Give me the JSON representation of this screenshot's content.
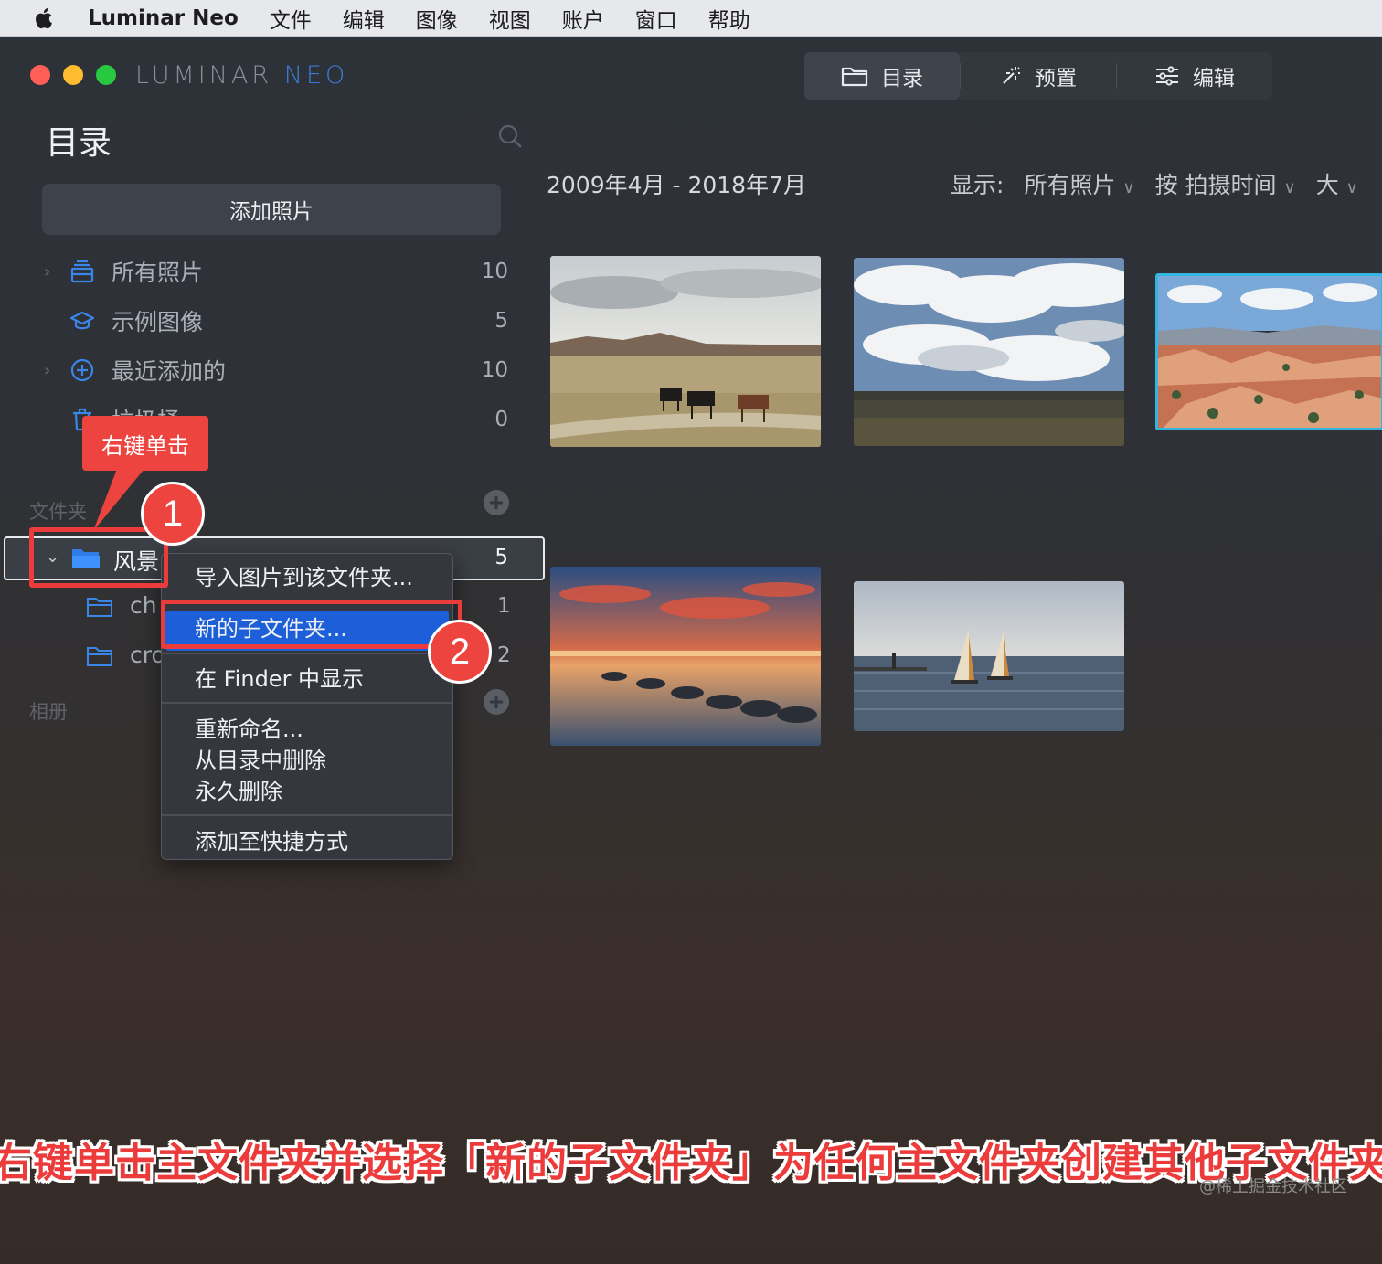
{
  "menubar": {
    "app": "Luminar Neo",
    "items": [
      "文件",
      "编辑",
      "图像",
      "视图",
      "账户",
      "窗口",
      "帮助"
    ]
  },
  "logo": {
    "part1": "LUMINAR",
    "part2": "NEO"
  },
  "topnav": {
    "tabs": [
      {
        "label": "目录",
        "icon": "folder-icon",
        "active": true
      },
      {
        "label": "预置",
        "icon": "magic-wand-icon",
        "active": false
      },
      {
        "label": "编辑",
        "icon": "sliders-icon",
        "active": false
      }
    ]
  },
  "sidebar": {
    "title": "目录",
    "add_button": "添加照片",
    "items": [
      {
        "label": "所有照片",
        "count": "10",
        "icon": "photos-stack-icon"
      },
      {
        "label": "示例图像",
        "count": "5",
        "icon": "graduation-cap-icon"
      },
      {
        "label": "最近添加的",
        "count": "10",
        "icon": "plus-circle-icon"
      },
      {
        "label": "垃圾桶",
        "count": "0",
        "icon": "trash-icon"
      }
    ],
    "folders_section": "文件夹",
    "folder": {
      "label": "风景",
      "count": "5"
    },
    "subfolders": [
      {
        "label": "ch",
        "count": "1"
      },
      {
        "label": "cro",
        "count": "2"
      }
    ],
    "albums_section": "相册"
  },
  "context_menu": {
    "items": [
      "导入图片到该文件夹...",
      "新的子文件夹...",
      "在 Finder 中显示",
      "重新命名...",
      "从目录中删除",
      "永久删除",
      "添加至快捷方式"
    ],
    "highlighted": "新的子文件夹..."
  },
  "annotations": {
    "callout": "右键单击",
    "badge1": "1",
    "badge2": "2",
    "caption": "右键单击主文件夹并选择「新的子文件夹」为任何主文件夹创建其他子文件夹",
    "watermark": "@稀土掘金技术社区"
  },
  "main": {
    "date_range": "2009年4月 - 2018年7月",
    "show_label": "显示:",
    "show_value": "所有照片",
    "sort_value": "按 拍摄时间",
    "size_value": "大"
  },
  "colors": {
    "accent": "#1c5fd8",
    "annotation_red": "#ec3b3b",
    "selection_cyan": "#34b4e0",
    "sidebar_icon_blue": "#3a86e8"
  }
}
